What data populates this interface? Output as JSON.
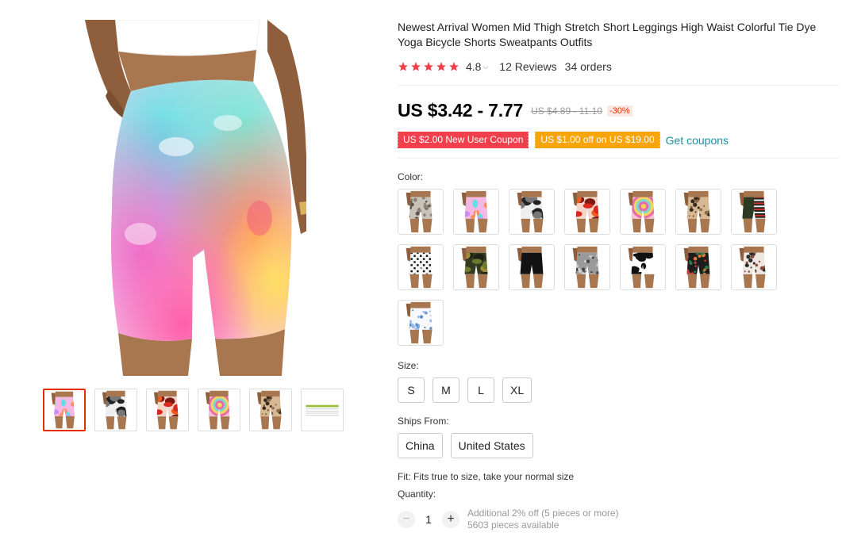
{
  "product": {
    "title": "Newest Arrival Women Mid Thigh Stretch Short Leggings High Waist Colorful Tie Dye Yoga Bicycle Shorts Sweatpants Outfits",
    "rating": "4.8",
    "reviews": "12 Reviews",
    "orders": "34 orders",
    "price": "US $3.42 - 7.77",
    "original_price": "US $4.89 - 11.10",
    "discount": "-30%"
  },
  "coupons": {
    "new_user": "US $2.00 New User Coupon",
    "threshold": "US $1.00 off on US $19.00",
    "get_coupons": "Get coupons"
  },
  "options": {
    "color_label": "Color:",
    "size_label": "Size:",
    "sizes": [
      "S",
      "M",
      "L",
      "XL"
    ],
    "ships_label": "Ships From:",
    "ships_from": [
      "China",
      "United States"
    ],
    "fit_text": "Fit: Fits true to size, take your normal size"
  },
  "quantity": {
    "label": "Quantity:",
    "value": "1",
    "minus": "−",
    "plus": "+",
    "discount_note": "Additional 2% off (5 pieces or more)",
    "available": "5603 pieces available"
  },
  "colors": {
    "star": "#f0404b",
    "accent_red": "#e62e04",
    "coupon_red": "#f0404b",
    "coupon_orange": "#f7a50a",
    "link": "#1a8fa0"
  },
  "swatch_patterns": [
    "snake",
    "tiedye",
    "camo-bw",
    "red-splash",
    "spiral",
    "leopard",
    "stripes-flag",
    "houndstooth",
    "camo-green",
    "black",
    "snake-grey",
    "cow",
    "floral-dark",
    "paisley",
    "dino-white"
  ],
  "thumb_patterns": [
    "tiedye",
    "camo-bw",
    "red-splash",
    "spiral",
    "leopard",
    "size-chart"
  ]
}
